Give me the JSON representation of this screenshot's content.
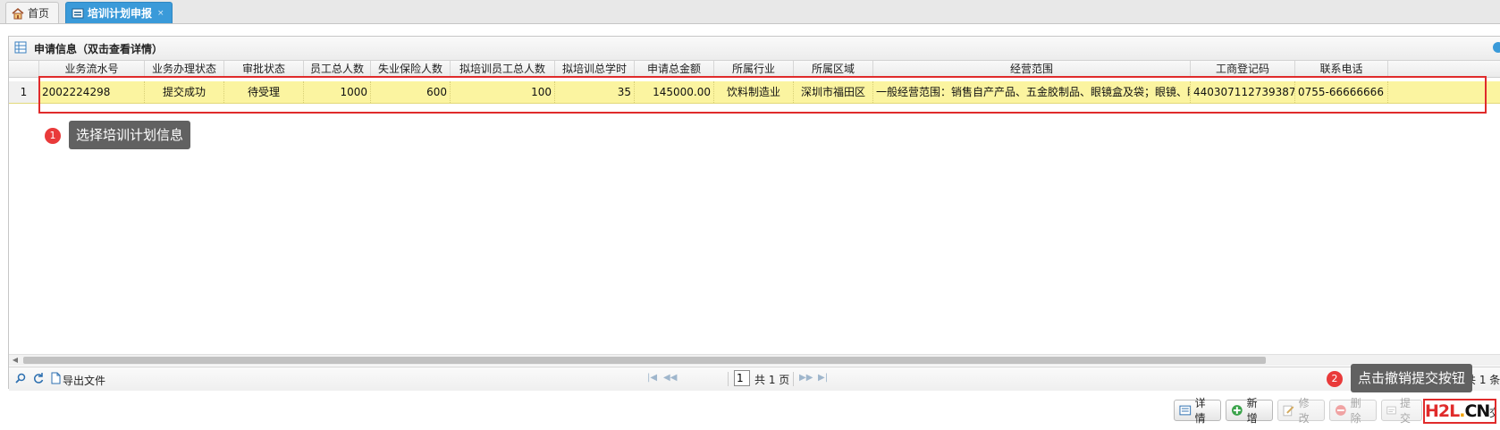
{
  "tabs": [
    {
      "label": "首页"
    },
    {
      "label": "培训计划申报",
      "close": "×"
    }
  ],
  "panel": {
    "title": "申请信息（双击查看详情）"
  },
  "grid": {
    "columns": [
      "业务流水号",
      "业务办理状态",
      "审批状态",
      "员工总人数",
      "失业保险人数",
      "拟培训员工总人数",
      "拟培训总学时",
      "申请总金额",
      "所属行业",
      "所属区域",
      "经营范围",
      "工商登记码",
      "联系电话"
    ],
    "rows": [
      {
        "rownum": "1",
        "cells": [
          "2002224298",
          "提交成功",
          "待受理",
          "1000",
          "600",
          "100",
          "35",
          "145000.00",
          "饮料制造业",
          "深圳市福田区",
          "一般经营范围：销售自产产品、五金胶制品、眼镜盒及袋；眼镜、眼镜配",
          "440307112739387",
          "0755-66666666"
        ]
      }
    ]
  },
  "callouts": [
    {
      "num": "1",
      "text": "选择培训计划信息"
    },
    {
      "num": "2",
      "text": "点击撤销提交按钮"
    }
  ],
  "pager": {
    "export_label": "导出文件",
    "current_page": "1",
    "total_label": "共 1 页",
    "record_count_fragment": "共 1 条"
  },
  "buttons": {
    "detail": "详情",
    "add": "新增",
    "edit": "修改",
    "delete": "删除",
    "submit": "提交",
    "cancel_submit_fragment": "交"
  },
  "watermark": {
    "p1": "H2L",
    "p2": ".",
    "p3": "CN"
  },
  "colors": {
    "accent": "#3a9ad9",
    "highlight_row": "#fbf4a0",
    "callout_red": "#e02b2b",
    "tip_bg": "#616161"
  }
}
